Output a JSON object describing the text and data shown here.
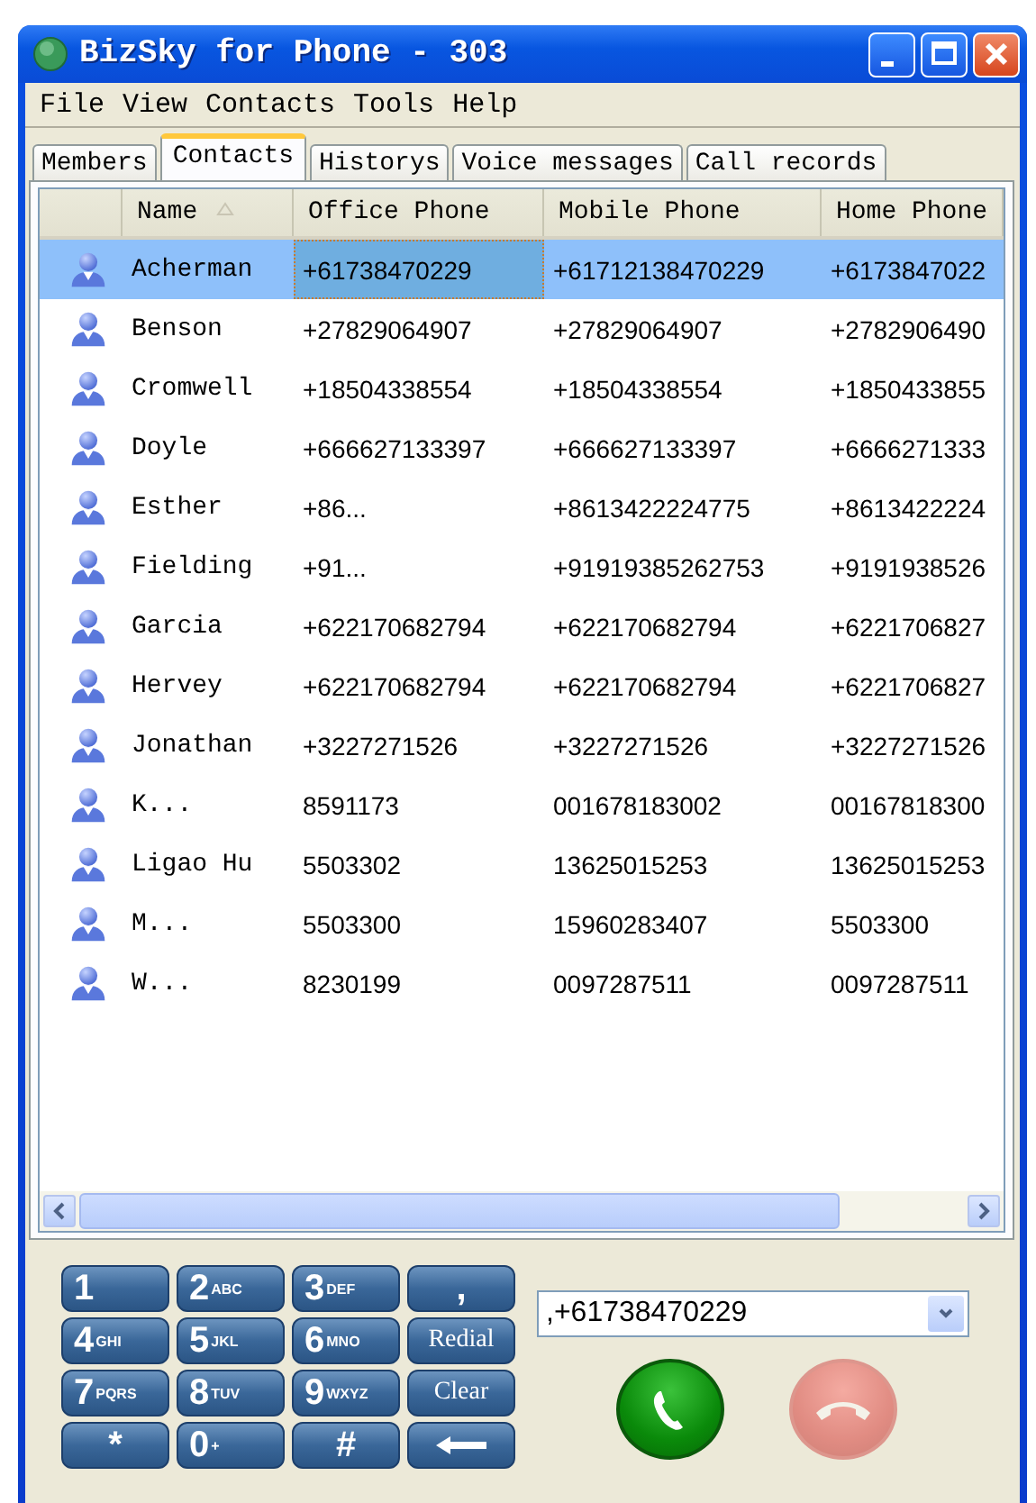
{
  "window": {
    "title": "BizSky for Phone - 303"
  },
  "menu": [
    "File",
    "View",
    "Contacts",
    "Tools",
    "Help"
  ],
  "tabs": [
    {
      "label": "Members",
      "selected": false
    },
    {
      "label": "Contacts",
      "selected": true
    },
    {
      "label": "Historys",
      "selected": false
    },
    {
      "label": "Voice messages",
      "selected": false
    },
    {
      "label": "Call records",
      "selected": false
    }
  ],
  "table": {
    "columns": [
      {
        "label": "Name",
        "sorted": true
      },
      {
        "label": "Office Phone",
        "sorted": false
      },
      {
        "label": "Mobile Phone",
        "sorted": false
      },
      {
        "label": "Home Phone",
        "sorted": false
      }
    ],
    "rows": [
      {
        "name": "Acherman",
        "office_phone": "+61738470229",
        "mobile_phone": "+61712138470229",
        "home_phone": "+6173847022",
        "selected": true
      },
      {
        "name": "Benson",
        "office_phone": "+27829064907",
        "mobile_phone": "+27829064907",
        "home_phone": "+2782906490",
        "selected": false
      },
      {
        "name": "Cromwell",
        "office_phone": "+18504338554",
        "mobile_phone": "+18504338554",
        "home_phone": "+1850433855",
        "selected": false
      },
      {
        "name": "Doyle",
        "office_phone": "+666627133397",
        "mobile_phone": "+666627133397",
        "home_phone": "+6666271333",
        "selected": false
      },
      {
        "name": "Esther",
        "office_phone": "+86...",
        "mobile_phone": "+8613422224775",
        "home_phone": "+8613422224",
        "selected": false
      },
      {
        "name": "Fielding",
        "office_phone": "+91...",
        "mobile_phone": "+91919385262753",
        "home_phone": "+9191938526",
        "selected": false
      },
      {
        "name": "Garcia",
        "office_phone": "+622170682794",
        "mobile_phone": "+622170682794",
        "home_phone": "+6221706827",
        "selected": false
      },
      {
        "name": "Hervey",
        "office_phone": "+622170682794",
        "mobile_phone": "+622170682794",
        "home_phone": "+6221706827",
        "selected": false
      },
      {
        "name": "Jonathan",
        "office_phone": "+3227271526",
        "mobile_phone": "+3227271526",
        "home_phone": "+3227271526",
        "selected": false
      },
      {
        "name": "K...",
        "office_phone": "8591173",
        "mobile_phone": "001678183002",
        "home_phone": "00167818300",
        "selected": false
      },
      {
        "name": "Ligao Hu",
        "office_phone": "5503302",
        "mobile_phone": "13625015253",
        "home_phone": "13625015253",
        "selected": false
      },
      {
        "name": "M...",
        "office_phone": "5503300",
        "mobile_phone": "15960283407",
        "home_phone": "5503300",
        "selected": false
      },
      {
        "name": "W...",
        "office_phone": "8230199",
        "mobile_phone": "0097287511",
        "home_phone": "0097287511",
        "selected": false
      }
    ]
  },
  "dialer": {
    "keys": [
      {
        "kind": "digit",
        "digit": "1"
      },
      {
        "kind": "digit",
        "digit": "2",
        "letters": "ABC"
      },
      {
        "kind": "digit",
        "digit": "3",
        "letters": "DEF"
      },
      {
        "kind": "text",
        "label": ","
      },
      {
        "kind": "digit",
        "digit": "4",
        "letters": "GHI"
      },
      {
        "kind": "digit",
        "digit": "5",
        "letters": "JKL"
      },
      {
        "kind": "digit",
        "digit": "6",
        "letters": "MNO"
      },
      {
        "kind": "text",
        "label": "Redial"
      },
      {
        "kind": "digit",
        "digit": "7",
        "letters": "PQRS"
      },
      {
        "kind": "digit",
        "digit": "8",
        "letters": "TUV"
      },
      {
        "kind": "digit",
        "digit": "9",
        "letters": "WXYZ"
      },
      {
        "kind": "text",
        "label": "Clear"
      },
      {
        "kind": "text",
        "label": "*"
      },
      {
        "kind": "digit",
        "digit": "0",
        "letters": "+"
      },
      {
        "kind": "text",
        "label": "#"
      },
      {
        "kind": "backspace"
      }
    ],
    "number": ",+61738470229",
    "call_button": {
      "disabled": false
    },
    "hangup_button": {
      "disabled": true
    }
  }
}
